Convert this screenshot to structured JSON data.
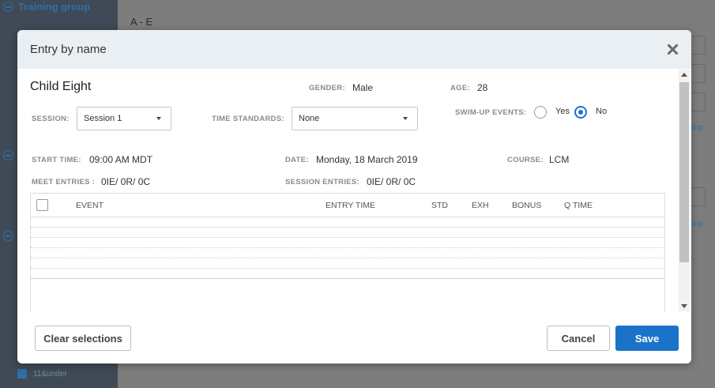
{
  "background": {
    "group_title": "Training group",
    "section_heading": "A - E",
    "under_label": "11&under",
    "stop_link": "top"
  },
  "modal": {
    "title": "Entry by name",
    "athlete": {
      "name": "Child Eight",
      "gender_label": "GENDER:",
      "gender": "Male",
      "age_label": "AGE:",
      "age": "28"
    },
    "session": {
      "label": "SESSION:",
      "selected": "Session 1"
    },
    "time_standards": {
      "label": "TIME STANDARDS:",
      "selected": "None"
    },
    "swim_up": {
      "label": "SWIM-UP EVENTS:",
      "yes_label": "Yes",
      "no_label": "No",
      "selected": "No"
    },
    "details": {
      "start_time_label": "START TIME:",
      "start_time": "09:00 AM MDT",
      "date_label": "DATE:",
      "date": "Monday, 18 March 2019",
      "course_label": "COURSE:",
      "course": "LCM",
      "meet_entries_label": "MEET ENTRIES :",
      "meet_entries": "0IE/ 0R/ 0C",
      "session_entries_label": "SESSION ENTRIES:",
      "session_entries": "0IE/ 0R/ 0C"
    },
    "table": {
      "headers": {
        "event": "EVENT",
        "entry_time": "ENTRY TIME",
        "std": "STD",
        "exh": "EXH",
        "bonus": "BONUS",
        "q_time": "Q TIME"
      }
    },
    "footer": {
      "clear_label": "Clear selections",
      "cancel_label": "Cancel",
      "save_label": "Save"
    }
  },
  "colors": {
    "primary": "#1a73c9",
    "header_bg": "#e9eff3",
    "overlay_sidebar": "#3f4a56"
  }
}
